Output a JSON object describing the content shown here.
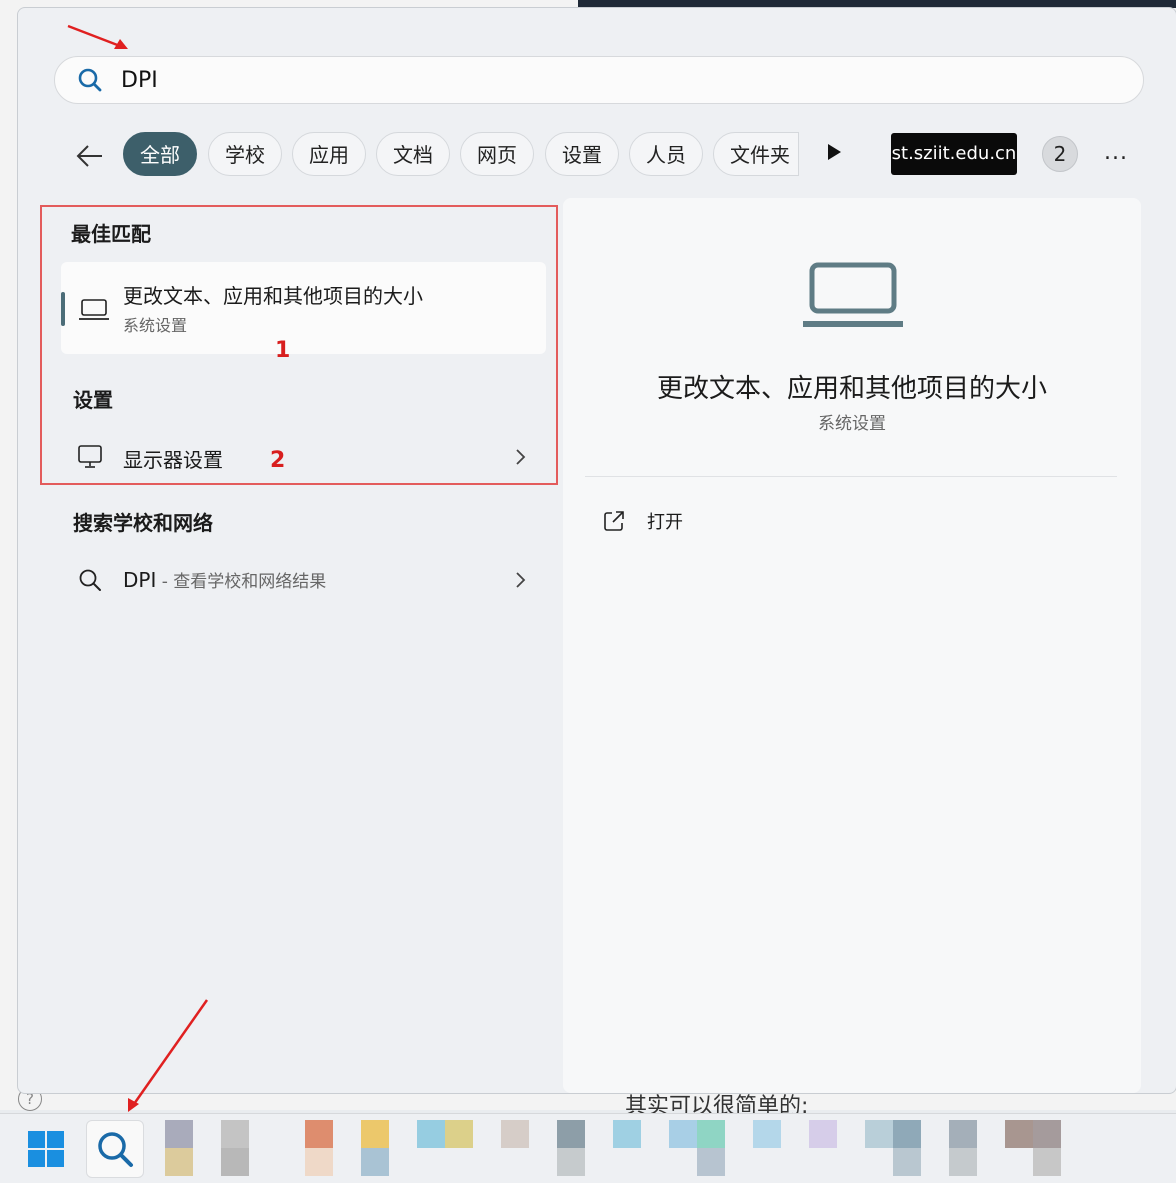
{
  "search": {
    "value": "DPI",
    "placeholder": ""
  },
  "filters": {
    "chips": [
      "全部",
      "学校",
      "应用",
      "文档",
      "网页",
      "设置",
      "人员",
      "文件夹"
    ],
    "org": "st.sziit.edu.cn",
    "count": "2",
    "more": "..."
  },
  "left": {
    "best_match_title": "最佳匹配",
    "best_match": {
      "title": "更改文本、应用和其他项目的大小",
      "subtitle": "系统设置"
    },
    "settings_title": "设置",
    "settings_item": "显示器设置",
    "web_title": "搜索学校和网络",
    "web_item": {
      "query": "DPI",
      "suffix": " - 查看学校和网络结果"
    }
  },
  "preview": {
    "title": "更改文本、应用和其他项目的大小",
    "subtitle": "系统设置",
    "open_label": "打开"
  },
  "annotations": {
    "mark1": "1",
    "mark2": "2",
    "accent": "#e02020"
  },
  "background": {
    "doc_text": "其实可以很简单的:",
    "help": "?"
  },
  "colors": {
    "accent": "#3d5f6a",
    "chip_bg": "#f4f5f7"
  }
}
